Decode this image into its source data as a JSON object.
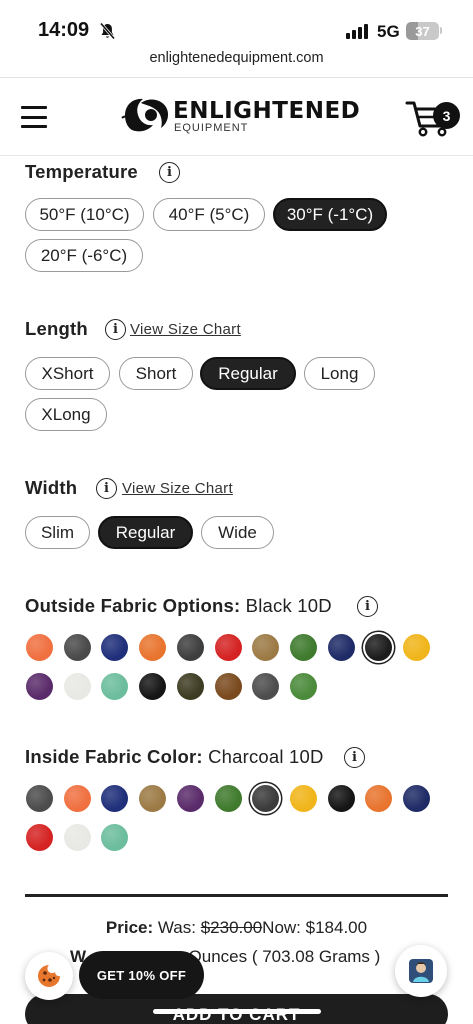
{
  "status_bar": {
    "time": "14:09",
    "network": "5G",
    "battery": "37",
    "battery_level": 0.37
  },
  "browser": {
    "url": "enlightenedequipment.com"
  },
  "header": {
    "brand": "ENLIGHTENED",
    "brand_sub": "EQUIPMENT",
    "cart_count": "3"
  },
  "temperature": {
    "title": "Temperature",
    "options": [
      "50°F (10°C)",
      "40°F (5°C)",
      "30°F (-1°C)",
      "20°F (-6°C)"
    ],
    "selected": "30°F (-1°C)"
  },
  "length": {
    "title": "Length",
    "size_chart_link": "View Size Chart",
    "options": [
      "XShort",
      "Short",
      "Regular",
      "Long",
      "XLong"
    ],
    "selected": "Regular"
  },
  "width": {
    "title": "Width",
    "size_chart_link": "View Size Chart",
    "options": [
      "Slim",
      "Regular",
      "Wide"
    ],
    "selected": "Regular"
  },
  "outside_fabric": {
    "title": "Outside Fabric Options:",
    "selected_label": "Black 10D",
    "swatch_colors": [
      "#f07040",
      "#4a4a4a",
      "#1f2f7a",
      "#e8742e",
      "#3e3e3e",
      "#d52323",
      "#9c7a45",
      "#3f7a2d",
      "#1e2b66",
      "#1c1c1c",
      "#f0b51a",
      "#5a2b6a",
      "#e8e8e4",
      "#6cbd9d",
      "#151515",
      "#3d3b22",
      "#7a4a1e",
      "#4d4d4d",
      "#4a8a3a"
    ],
    "selected_index": 9
  },
  "inside_fabric": {
    "title": "Inside Fabric Color:",
    "selected_label": "Charcoal 10D",
    "swatch_colors": [
      "#4c4c4c",
      "#f07040",
      "#1f2f7a",
      "#9c7a45",
      "#5a2b6a",
      "#3f7a2d",
      "#3b3b3b",
      "#f0b51a",
      "#151515",
      "#e8742e",
      "#1e2b66",
      "#d52323",
      "#e8e8e4",
      "#6cbd9d"
    ],
    "selected_index": 6
  },
  "price": {
    "label": "Price:",
    "was_label": "Was:",
    "was_value": "$230.00",
    "now_label": "Now:",
    "now_value": "$184.00"
  },
  "weight": {
    "label_visible": "W",
    "value_visible": "Ounces ( 703.08 Grams )"
  },
  "floating": {
    "promo": "GET 10% OFF",
    "cookie_icon": "cookie-icon",
    "chat_icon": "chat-avatar-icon"
  },
  "add_to_cart": "ADD TO CART",
  "colors": {
    "accent": "#222222",
    "selected_fill": "#222222"
  }
}
